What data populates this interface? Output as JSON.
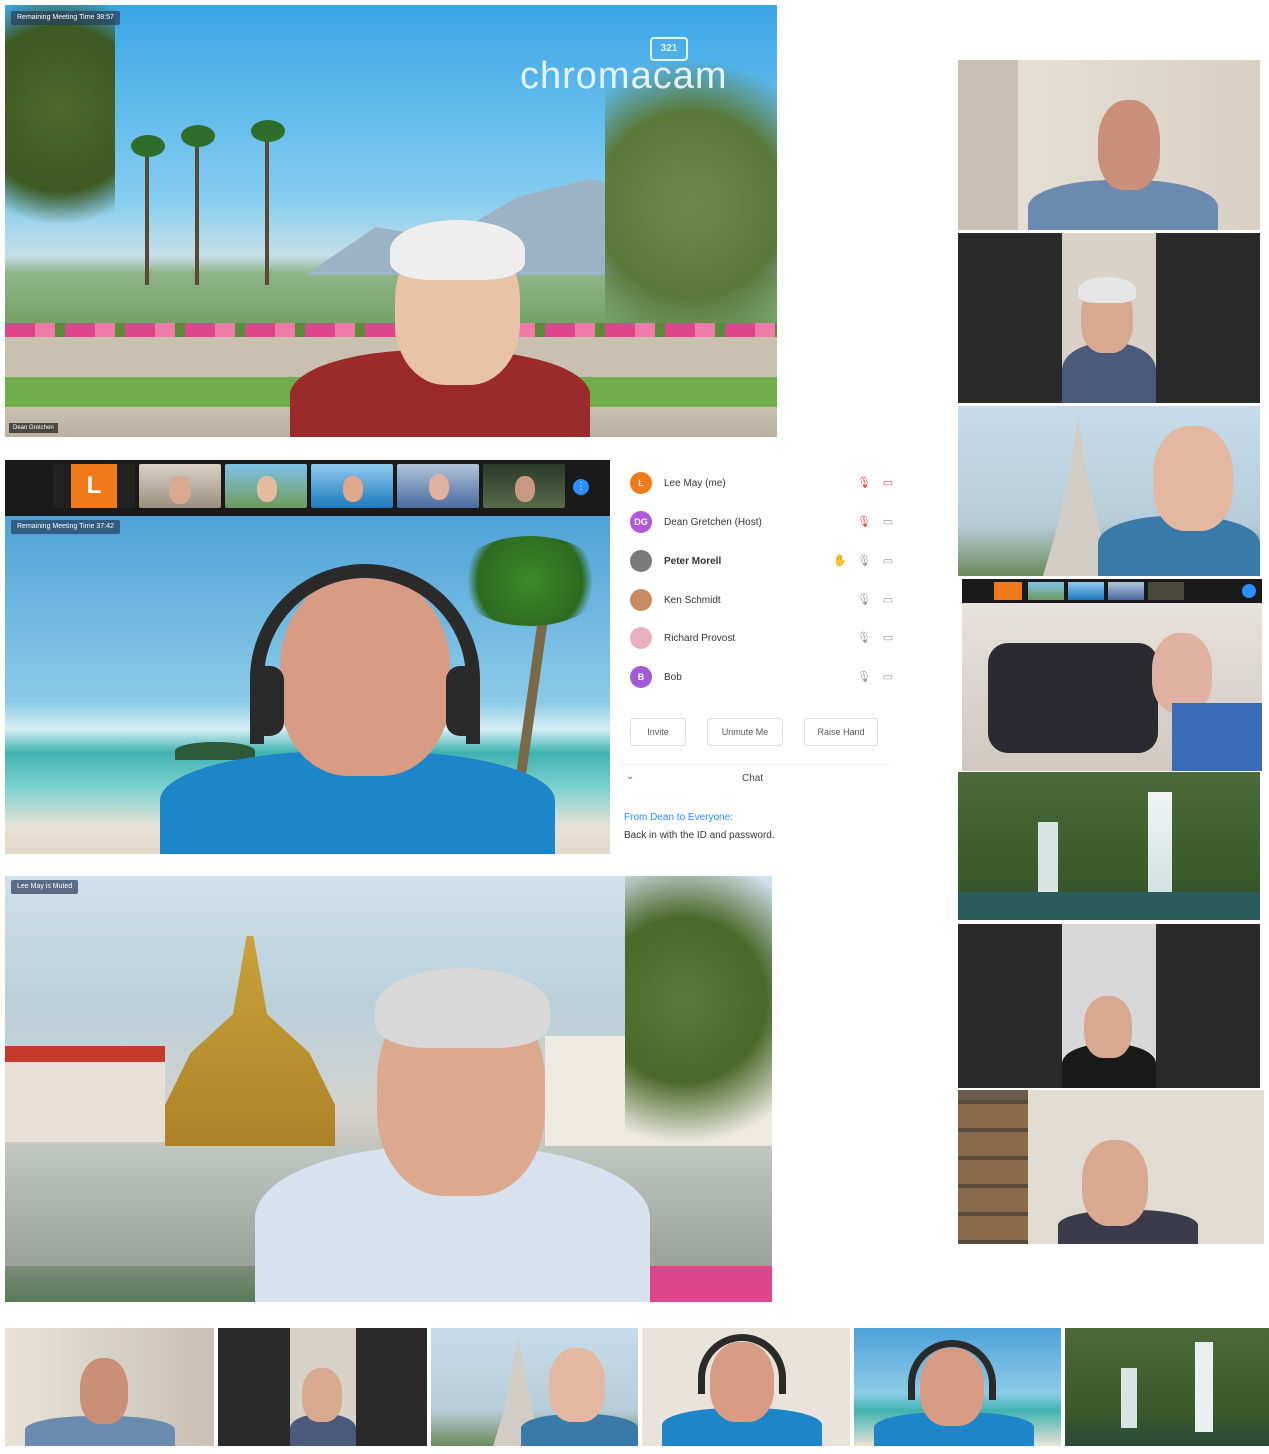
{
  "main_speaker": {
    "badge": "Remaining Meeting Time 38:57",
    "watermark_line": "chromacam",
    "watermark_small": "321",
    "name": "Dean Gretchen"
  },
  "thumbstrip": {
    "self_initial": "L"
  },
  "middle_speaker": {
    "badge": "Remaining Meeting Time 37:42"
  },
  "bottom_speaker": {
    "badge": "Lee May is Muted"
  },
  "participants": {
    "items": [
      {
        "initial": "L",
        "name": "Lee May (me)",
        "avatar_color": "#f07a1a"
      },
      {
        "initial": "DG",
        "name": "Dean Gretchen (Host)",
        "avatar_color": "#b05ad6"
      },
      {
        "initial": "",
        "name": "Peter Morell",
        "avatar_color": "#8a8a8a"
      },
      {
        "initial": "",
        "name": "Ken Schmidt",
        "avatar_color": "#c88a60"
      },
      {
        "initial": "",
        "name": "Richard Provost",
        "avatar_color": "#e9b0c0"
      },
      {
        "initial": "B",
        "name": "Bob",
        "avatar_color": "#a25ad6"
      }
    ],
    "buttons": {
      "invite": "Invite",
      "unmute": "Unmute Me",
      "raise_hand": "Raise Hand"
    }
  },
  "chat": {
    "title": "Chat",
    "from": "From Dean to Everyone:",
    "message": "Back in with the ID and password."
  },
  "colors": {
    "accent": "#f07a1a",
    "host_purple": "#b05ad6",
    "link": "#2d8cff",
    "mute_red": "#e5484d"
  }
}
